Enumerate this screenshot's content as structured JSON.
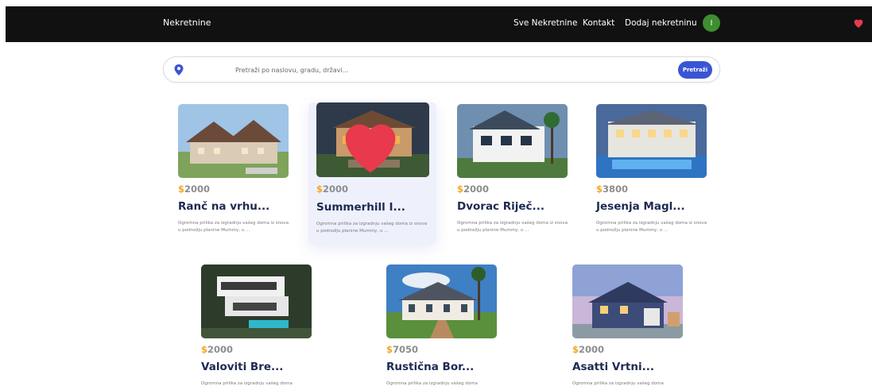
{
  "navbar": {
    "brand": "Nekretnine",
    "links": [
      "Sve Nekretnine",
      "Kontakt",
      "Dodaj nekretninu"
    ],
    "avatar_initial": "I",
    "heart_color": "#e8394d"
  },
  "search": {
    "placeholder": "Pretraži po naslovu, gradu, državi...",
    "value": "",
    "button_label": "Pretraži",
    "accent_color": "#3a55d4",
    "pin_icon": "location-pin-icon"
  },
  "currency_symbol": "$",
  "listings": [
    {
      "price": "2000",
      "title": "Ranč na vrhu...",
      "description": "Ogromna prilika za izgradnju vašeg doma iz snova u podnožju planine Mummy, u ...",
      "favorited": false,
      "highlighted": false
    },
    {
      "price": "2000",
      "title": "Summerhill I...",
      "description": "Ogromna prilika za izgradnju vašeg doma iz snova u podnožju planine Mummy, u ...",
      "favorited": true,
      "highlighted": true
    },
    {
      "price": "2000",
      "title": "Dvorac Riječ...",
      "description": "Ogromna prilika za izgradnju vašeg doma iz snova u podnožju planine Mummy, u ...",
      "favorited": false,
      "highlighted": false
    },
    {
      "price": "3800",
      "title": "Jesenja Magl...",
      "description": "Ogromna prilika za izgradnju vašeg doma iz snova u podnožju planine Mummy, u ...",
      "favorited": false,
      "highlighted": false
    },
    {
      "price": "2000",
      "title": "Valoviti Bre...",
      "description": "Ogromna prilika za izgradnju vašeg doma",
      "favorited": false,
      "highlighted": false
    },
    {
      "price": "7050",
      "title": "Rustična Bor...",
      "description": "Ogromna prilika za izgradnju vašeg doma",
      "favorited": false,
      "highlighted": false
    },
    {
      "price": "2000",
      "title": "Asatti Vrtni...",
      "description": "Ogromna prilika za izgradnju vašeg doma",
      "favorited": false,
      "highlighted": false
    }
  ],
  "colors": {
    "price_currency": "#f4a622",
    "title": "#1d2a52",
    "navbar_bg": "#111111",
    "avatar_bg": "#3e8e2f"
  }
}
